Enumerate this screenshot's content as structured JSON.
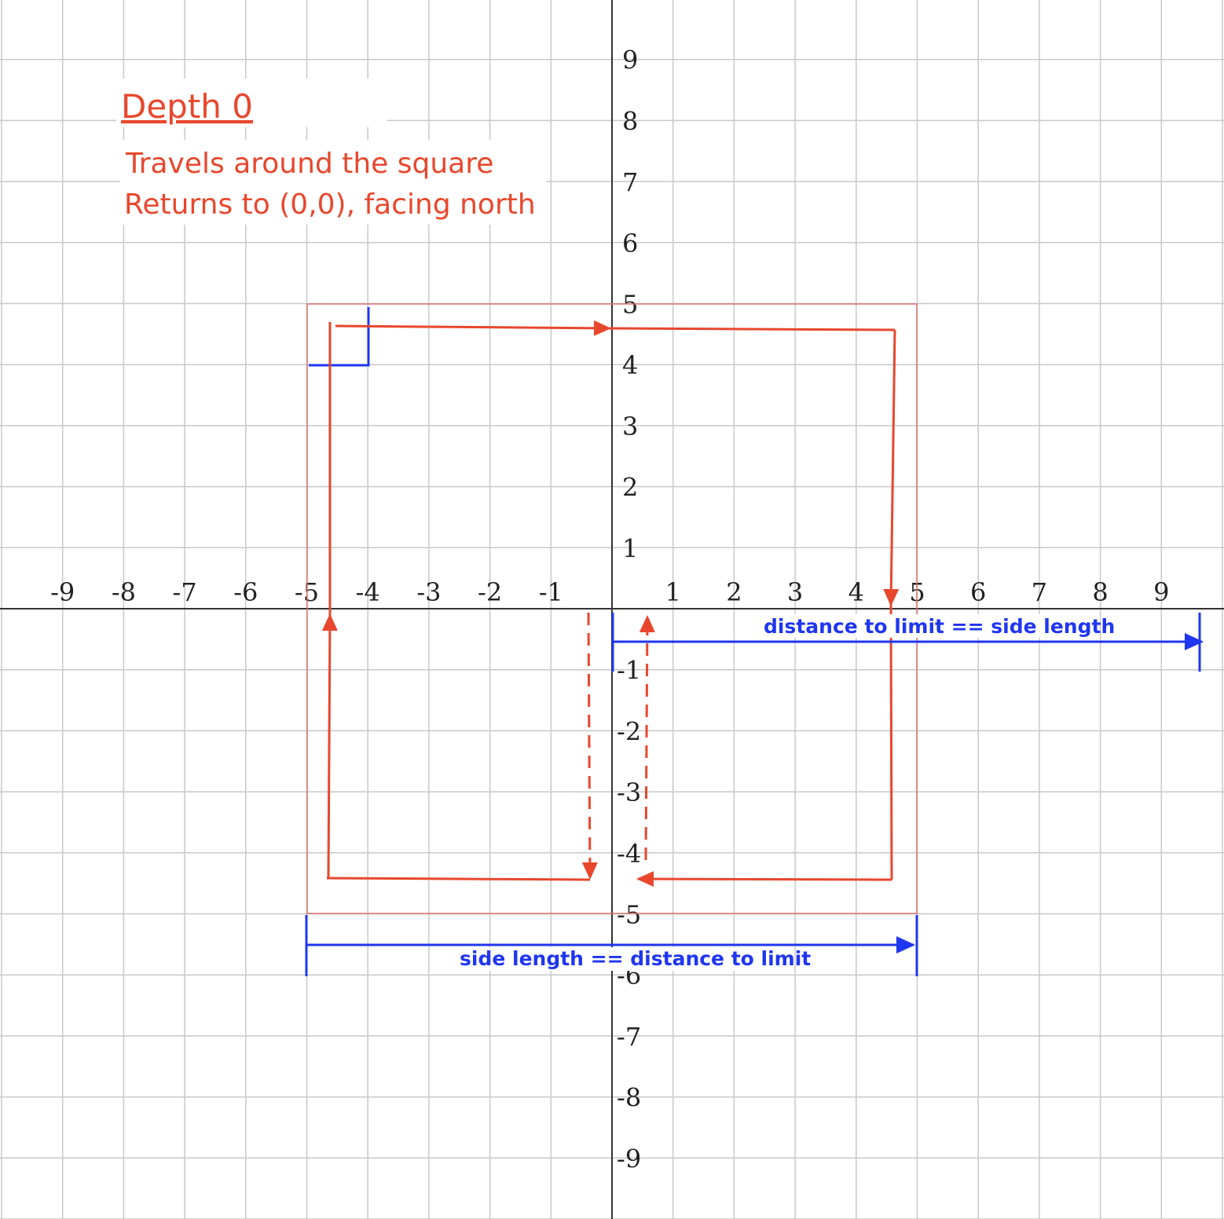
{
  "title": "Depth 0",
  "notes": [
    "Travels around the square",
    "Returns to (0,0), facing north"
  ],
  "x_ticks": [
    "-9",
    "-8",
    "-7",
    "-6",
    "-5",
    "-4",
    "-3",
    "-2",
    "-1",
    "1",
    "2",
    "3",
    "4",
    "5",
    "6",
    "7",
    "8",
    "9"
  ],
  "y_ticks": [
    "9",
    "8",
    "7",
    "6",
    "5",
    "4",
    "3",
    "2",
    "1",
    "-1",
    "-2",
    "-3",
    "-4",
    "-5",
    "-6",
    "-7",
    "-8",
    "-9"
  ],
  "labels": {
    "distance_right": "distance to limit == side length",
    "side_length_bottom": "side length == distance to limit"
  },
  "colors": {
    "grid": "#c8c8c8",
    "axis": "#333333",
    "path": "#e8472d",
    "square": "#e07070",
    "measure": "#1f36f0"
  }
}
